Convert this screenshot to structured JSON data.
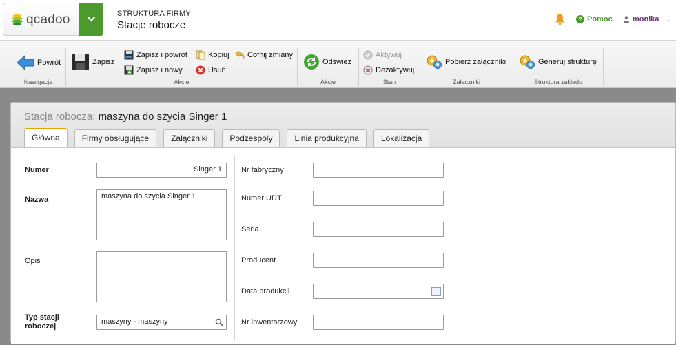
{
  "header": {
    "logo_text": "qcadoo",
    "section": "STRUKTURA FIRMY",
    "title": "Stacje robocze",
    "help": "Pomoc",
    "user": "monika"
  },
  "ribbon": {
    "groups": {
      "navigation": "Nawigacja",
      "actions": "Akcje",
      "actions2": "Akcje",
      "state": "Stan",
      "attachments": "Załączniki",
      "structure": "Struktura zakładu"
    },
    "buttons": {
      "back": "Powrót",
      "save": "Zapisz",
      "save_back": "Zapisz i powrót",
      "save_new": "Zapisz i nowy",
      "copy": "Kopiuj",
      "delete": "Usuń",
      "undo": "Cofnij zmiany",
      "refresh": "Odśwież",
      "activate": "Aktywuj",
      "deactivate": "Dezaktywuj",
      "download_attachments": "Pobierz załączniki",
      "generate_structure": "Generuj strukturę"
    }
  },
  "record": {
    "label": "Stacja robocza:",
    "name": "maszyna do szycia Singer 1"
  },
  "tabs": [
    "Główna",
    "Firmy obsługujące",
    "Załączniki",
    "Podzespoły",
    "Linia produkcyjna",
    "Lokalizacja"
  ],
  "form": {
    "left": {
      "number_label": "Numer",
      "number_value": "Singer 1",
      "name_label": "Nazwa",
      "name_value": "maszyna do szycia Singer 1",
      "description_label": "Opis",
      "description_value": "",
      "type_label_1": "Typ stacji",
      "type_label_2": "roboczej",
      "type_value": "maszyny - maszyny"
    },
    "right": {
      "serial_label": "Nr fabryczny",
      "udt_label": "Numer UDT",
      "series_label": "Seria",
      "producer_label": "Producent",
      "prod_date_label": "Data produkcji",
      "inventory_label": "Nr inwentarzowy"
    }
  },
  "colors": {
    "brand_green": "#4d9a2c",
    "active_tab_accent": "#e8a200",
    "user_purple": "#6b3a7a"
  },
  "icons": [
    "qcadoo-logo-icon",
    "chevron-down-icon",
    "bell-icon",
    "help-icon",
    "user-icon",
    "back-arrow-icon",
    "floppy-icon",
    "save-back-icon",
    "save-new-icon",
    "copy-icon",
    "delete-icon",
    "undo-icon",
    "refresh-icon",
    "activate-icon",
    "deactivate-icon",
    "gears-icon",
    "search-icon",
    "calendar-icon"
  ]
}
